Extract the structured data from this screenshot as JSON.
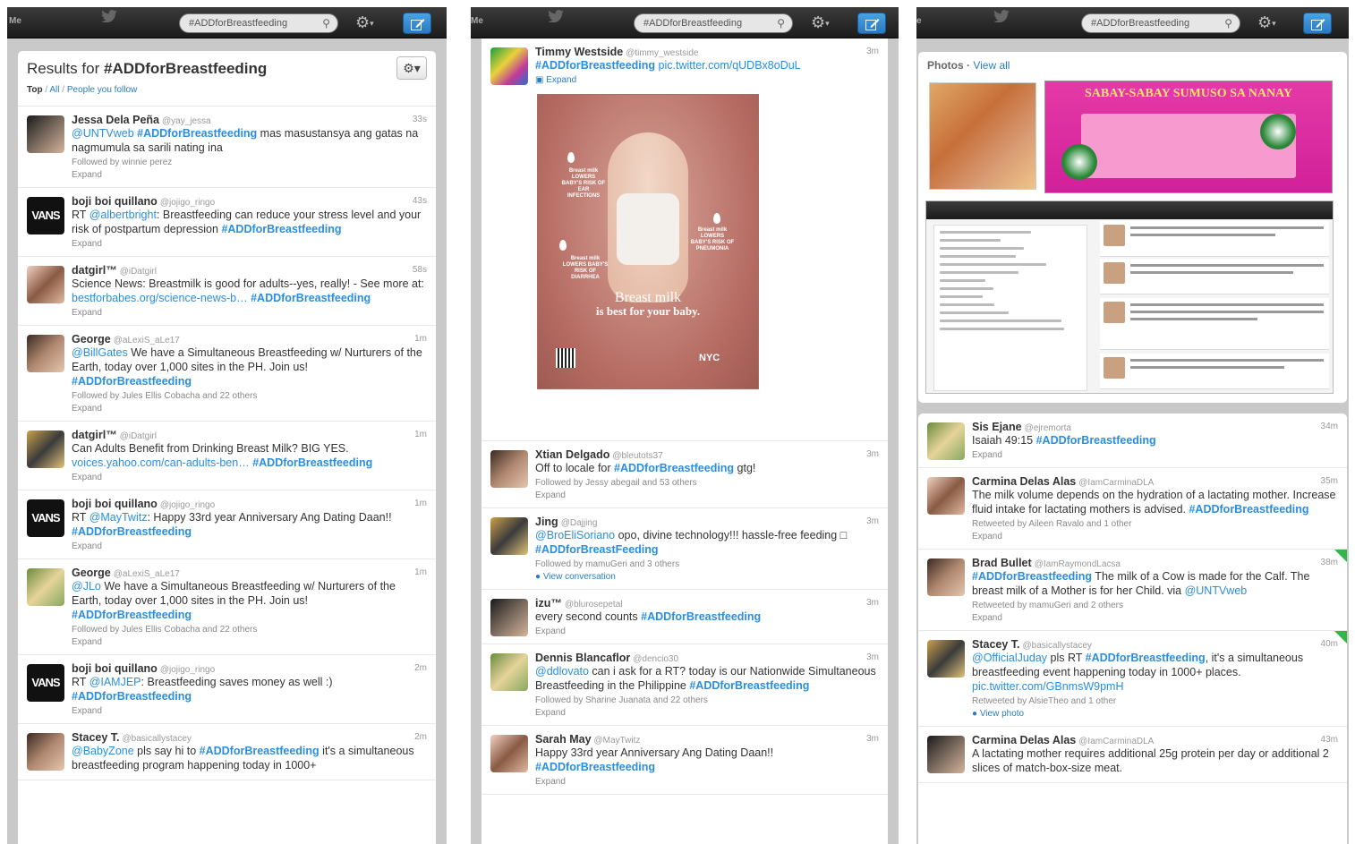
{
  "columns": [
    {
      "me_label": "Me",
      "search_value": "#ADDforBreastfeeding",
      "results": {
        "prefix": "Results for ",
        "query": "#ADDforBreastfeeding",
        "filter_top": "Top",
        "filter_all": "All",
        "filter_people": "People you follow"
      },
      "tweets": [
        {
          "name": "Jessa Dela Peña",
          "handle": "@yay_jessa",
          "time": "33s",
          "parts": [
            {
              "t": "@UNTVweb",
              "k": "ln"
            },
            {
              "t": " "
            },
            {
              "t": "#ADDforBreastfeeding",
              "k": "ht"
            },
            {
              "t": " mas masustansya ang gatas na nagmumula sa sarili nating ina"
            }
          ],
          "meta": "Followed by winnie perez",
          "expand": "Expand"
        },
        {
          "name": "boji boi quillano",
          "handle": "@jojigo_ringo",
          "time": "43s",
          "parts": [
            {
              "t": "RT "
            },
            {
              "t": "@albertbright",
              "k": "ln"
            },
            {
              "t": ": Breastfeeding can reduce your stress level and your risk of postpartum depression "
            },
            {
              "t": "#ADDforBreastfeeding",
              "k": "ht"
            }
          ],
          "meta": "",
          "expand": "Expand"
        },
        {
          "name": "datgirl™",
          "handle": "@iDatgirl",
          "time": "58s",
          "parts": [
            {
              "t": "Science News: Breastmilk is good for adults--yes, really! - See more at: "
            },
            {
              "t": "bestforbabes.org/science-news-b…",
              "k": "ln"
            },
            {
              "t": " "
            },
            {
              "t": "#ADDforBreastfeeding",
              "k": "ht"
            }
          ],
          "meta": "",
          "expand": "Expand"
        },
        {
          "name": "George",
          "handle": "@aLexiS_aLe17",
          "time": "1m",
          "parts": [
            {
              "t": "@BillGates",
              "k": "ln"
            },
            {
              "t": " We have a Simultaneous Breastfeeding w/ Nurturers of the Earth, today over 1,000 sites in the PH. Join us! "
            },
            {
              "t": "#ADDforBreastfeeding",
              "k": "ht"
            }
          ],
          "meta": "Followed by Jules Ellis Cobacha and 22 others",
          "expand": "Expand"
        },
        {
          "name": "datgirl™",
          "handle": "@iDatgirl",
          "time": "1m",
          "parts": [
            {
              "t": "Can Adults Benefit from Drinking Breast Milk? BIG YES. "
            },
            {
              "t": "voices.yahoo.com/can-adults-ben…",
              "k": "ln"
            },
            {
              "t": " "
            },
            {
              "t": "#ADDforBreastfeeding",
              "k": "ht"
            }
          ],
          "meta": "",
          "expand": "Expand"
        },
        {
          "name": "boji boi quillano",
          "handle": "@jojigo_ringo",
          "time": "1m",
          "parts": [
            {
              "t": "RT "
            },
            {
              "t": "@MayTwitz",
              "k": "ln"
            },
            {
              "t": ": Happy 33rd year Anniversary Ang Dating Daan!! "
            },
            {
              "t": "#ADDforBreastfeeding",
              "k": "ht"
            }
          ],
          "meta": "",
          "expand": "Expand"
        },
        {
          "name": "George",
          "handle": "@aLexiS_aLe17",
          "time": "1m",
          "parts": [
            {
              "t": "@JLo",
              "k": "ln"
            },
            {
              "t": " We have a Simultaneous Breastfeeding w/ Nurturers of the Earth, today over 1,000 sites in the PH. Join us! "
            },
            {
              "t": "#ADDforBreastfeeding",
              "k": "ht"
            }
          ],
          "meta": "Followed by Jules Ellis Cobacha and 22 others",
          "expand": "Expand"
        },
        {
          "name": "boji boi quillano",
          "handle": "@jojigo_ringo",
          "time": "2m",
          "parts": [
            {
              "t": "RT "
            },
            {
              "t": "@IAMJEP",
              "k": "ln"
            },
            {
              "t": ": Breastfeeding saves money as well :) "
            },
            {
              "t": "#ADDforBreastfeeding",
              "k": "ht"
            }
          ],
          "meta": "",
          "expand": "Expand"
        },
        {
          "name": "Stacey T.",
          "handle": "@basicallystacey",
          "time": "2m",
          "parts": [
            {
              "t": "@BabyZone",
              "k": "ln"
            },
            {
              "t": " pls say hi to "
            },
            {
              "t": "#ADDforBreastfeeding",
              "k": "ht"
            },
            {
              "t": " it's a simultaneous breastfeeding program happening today in 1000+"
            }
          ],
          "meta": "",
          "expand": ""
        }
      ]
    },
    {
      "search_value": "#ADDforBreastfeeding",
      "first_tweet": {
        "name": "Timmy Westside",
        "handle": "@timmy_westside",
        "time": "3m",
        "hashtag": "#ADDforBreastfeeding",
        "link": "pic.twitter.com/qUDBx8oDuL",
        "expand": "Expand",
        "poster": {
          "headline1": "Breast milk",
          "headline2": "is best for your baby.",
          "logo": "NYC",
          "labels": [
            "Breast milk LOWERS BABY'S RISK OF EAR INFECTIONS",
            "Breast milk LOWERS BABY'S RISK OF PNEUMONIA",
            "Breast milk LOWERS BABY'S RISK OF DIARRHEA"
          ]
        }
      },
      "tweets": [
        {
          "name": "Xtian Delgado",
          "handle": "@bleutots37",
          "time": "3m",
          "parts": [
            {
              "t": "Off to locale for "
            },
            {
              "t": "#ADDforBreastfeeding",
              "k": "ht"
            },
            {
              "t": " gtg!"
            }
          ],
          "meta": "Followed by Jessy abegail and 53 others",
          "expand": "Expand"
        },
        {
          "name": "Jing",
          "handle": "@Dajjing",
          "time": "3m",
          "parts": [
            {
              "t": "@BroEliSoriano",
              "k": "ln"
            },
            {
              "t": " opo, divine technology!!! hassle-free feeding □ "
            },
            {
              "t": "#ADDforBreastFeeding",
              "k": "ht"
            }
          ],
          "meta": "Followed by mamuGeri and 3 others",
          "expand": "View conversation"
        },
        {
          "name": "izu™",
          "handle": "@blurosepetal",
          "time": "3m",
          "parts": [
            {
              "t": "every second counts "
            },
            {
              "t": "#ADDforBreastfeeding",
              "k": "ht"
            }
          ],
          "meta": "",
          "expand": "Expand"
        },
        {
          "name": "Dennis Blancaflor",
          "handle": "@dencio30",
          "time": "3m",
          "parts": [
            {
              "t": "@ddlovato",
              "k": "ln"
            },
            {
              "t": " can i ask for a RT? today is our Nationwide Simultaneous Breastfeeding in the Philippine "
            },
            {
              "t": "#ADDforBreastfeeding",
              "k": "ht"
            }
          ],
          "meta": "Followed by Sharine Juanata and 22 others",
          "expand": "Expand"
        },
        {
          "name": "Sarah May",
          "handle": "@MayTwitz",
          "time": "3m",
          "parts": [
            {
              "t": "Happy 33rd year Anniversary Ang Dating Daan!! "
            },
            {
              "t": "#ADDforBreastfeeding",
              "k": "ht"
            }
          ],
          "meta": "",
          "expand": "Expand"
        }
      ]
    },
    {
      "search_value": "#ADDforBreastfeeding",
      "photos_label": "Photos",
      "view_all": "View all",
      "banner_title": "SABAY-SABAY SUMUSO SA NANAY",
      "tweets": [
        {
          "name": "Sis Ejane",
          "handle": "@ejremorta",
          "time": "34m",
          "parts": [
            {
              "t": "Isaiah 49:15 "
            },
            {
              "t": "#ADDforBreastfeeding",
              "k": "ht"
            }
          ],
          "meta": "",
          "expand": "Expand"
        },
        {
          "name": "Carmina Delas Alas",
          "handle": "@IamCarminaDLA",
          "time": "35m",
          "parts": [
            {
              "t": "The milk volume depends on the hydration of a lactating mother. Increase fluid intake for lactating mothers is advised. "
            },
            {
              "t": "#ADDforBreastfeeding",
              "k": "ht"
            }
          ],
          "meta": "Retweeted by Aileen Ravalo and 1 other",
          "expand": "Expand"
        },
        {
          "name": "Brad Bullet",
          "handle": "@IamRaymondLacsa",
          "time": "38m",
          "parts": [
            {
              "t": "#ADDforBreastfeeding",
              "k": "ht"
            },
            {
              "t": "  The milk of a Cow is made for the Calf. The breast milk of a Mother is for her Child. via "
            },
            {
              "t": "@UNTVweb",
              "k": "ln"
            }
          ],
          "meta": "Retweeted by mamuGeri and 2 others",
          "expand": "Expand"
        },
        {
          "name": "Stacey T.",
          "handle": "@basicallystacey",
          "time": "40m",
          "parts": [
            {
              "t": "@OfficialJuday",
              "k": "ln"
            },
            {
              "t": " pls RT "
            },
            {
              "t": "#ADDforBreastfeeding",
              "k": "ht"
            },
            {
              "t": ", it's a simultaneous breastfeeding event happening today in 1000+ places. "
            },
            {
              "t": "pic.twitter.com/GBnmsW9pmH",
              "k": "ln"
            }
          ],
          "meta": "Retweeted by AlsieTheo and 1 other",
          "expand": "View photo"
        },
        {
          "name": "Carmina Delas Alas",
          "handle": "@IamCarminaDLA",
          "time": "43m",
          "parts": [
            {
              "t": "A lactating mother requires additional 25g protein per day or additional 2 slices of match-box-size meat."
            }
          ],
          "meta": "",
          "expand": ""
        }
      ]
    }
  ]
}
